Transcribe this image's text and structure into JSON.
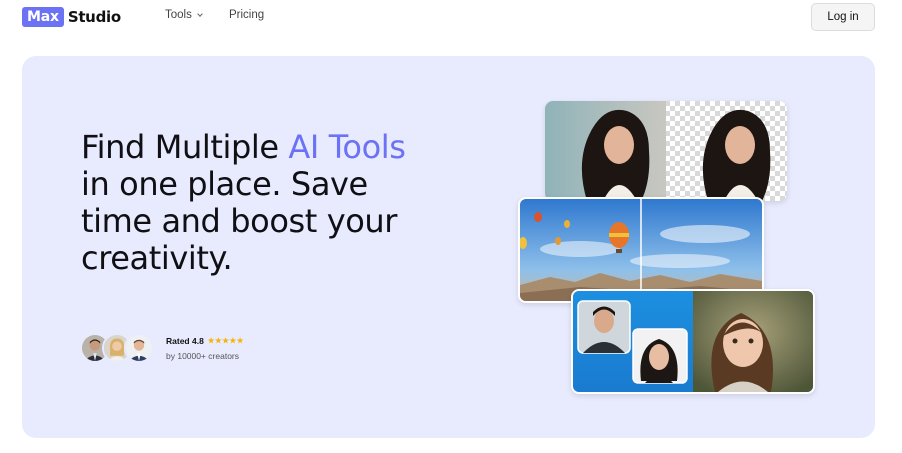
{
  "header": {
    "logo_badge": "Max",
    "logo_text": "Studio",
    "nav": {
      "tools": "Tools",
      "pricing": "Pricing"
    },
    "login": "Log in"
  },
  "hero": {
    "headline": {
      "part1": "Find Multiple ",
      "highlight": "AI Tools",
      "part2": " in one place. Save time and boost your creativity."
    },
    "rating": {
      "rated": "Rated 4.8",
      "stars": "★★★★★",
      "by": "by 10000+ creators"
    }
  },
  "colors": {
    "accent": "#6c72f4",
    "hero_bg": "#e8eafe",
    "star": "#f5b400"
  }
}
